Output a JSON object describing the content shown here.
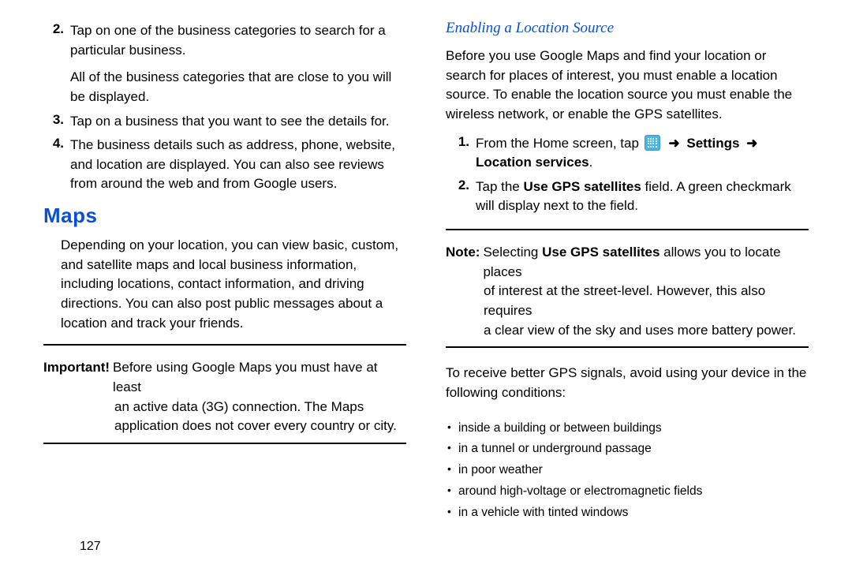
{
  "left": {
    "step2_num": "2.",
    "step2_text": "Tap on one of the business categories to search for a particular business.",
    "step2_sub": "All of the business categories that are close to you will be displayed.",
    "step3_num": "3.",
    "step3_text": "Tap on a business that you want to see the details for.",
    "step4_num": "4.",
    "step4_text": "The business details such as address, phone, website, and location are displayed. You can also see reviews from around the web and from Google users.",
    "maps_title": "Maps",
    "maps_para": "Depending on your location, you can view basic, custom, and satellite maps and local business information, including locations, contact information, and driving directions. You can also post public messages about a location and track your friends.",
    "important_label": "Important! ",
    "important_body_first": "Before using Google Maps you must have at least",
    "important_cont1": "an active data (3G) connection. The Maps",
    "important_cont2": "application does not cover every country or city.",
    "page_number": "127"
  },
  "right": {
    "sub_title": "Enabling a Location Source",
    "intro": "Before you use Google Maps and find your location or search for places of interest, you must enable a location source. To enable the location source you must enable the wireless network, or enable the GPS satellites.",
    "step1_num": "1.",
    "step1_text_a": "From the Home screen, tap",
    "arrow1": "➜",
    "step1_settings": "Settings",
    "arrow2": "➜",
    "step1_loc": "Location services",
    "step1_period": ".",
    "step2_num": "2.",
    "step2_text_a": "Tap the ",
    "step2_bold": "Use GPS satellites",
    "step2_text_b": " field. A green checkmark will display next to the field.",
    "note_label": "Note: ",
    "note_first_a": "Selecting ",
    "note_bold": "Use GPS satellites",
    "note_first_b": " allows you to locate places",
    "note_cont1": "of interest at the street-level. However, this also requires",
    "note_cont2": "a clear view of the sky and uses more battery power.",
    "gps_para": "To receive better GPS signals, avoid using your device in the following conditions:",
    "bullets": [
      "inside a building or between buildings",
      "in a tunnel or underground passage",
      "in poor weather",
      "around high-voltage or electromagnetic fields",
      "in a vehicle with tinted windows"
    ]
  }
}
